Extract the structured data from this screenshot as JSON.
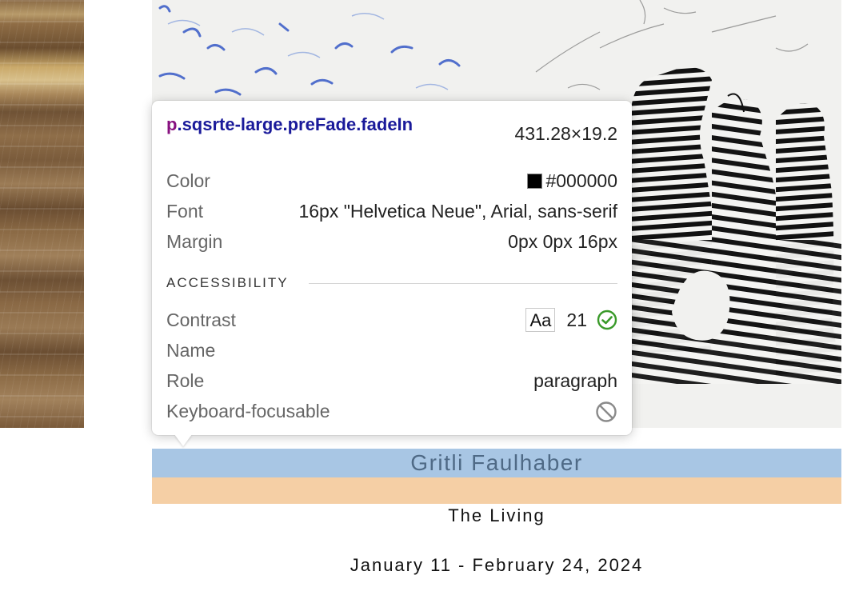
{
  "tooltip": {
    "selector_tag": "p",
    "selector_classes": ".sqsrte-large.preFade.fadeIn",
    "dimensions": "431.28×19.2",
    "color_label": "Color",
    "color_value": "#000000",
    "font_label": "Font",
    "font_value": "16px \"Helvetica Neue\", Arial, sans-serif",
    "margin_label": "Margin",
    "margin_value": "0px 0px 16px",
    "accessibility_heading": "ACCESSIBILITY",
    "contrast_label": "Contrast",
    "contrast_sample": "Aa",
    "contrast_value": "21",
    "contrast_icon": "check-circle-icon",
    "name_label": "Name",
    "role_label": "Role",
    "role_value": "paragraph",
    "keyboard_label": "Keyboard-focusable",
    "keyboard_icon": "not-allowed-icon"
  },
  "page": {
    "artist_name": "Gritli Faulhaber",
    "exhibit_title": "The Living",
    "exhibit_dates": "January 11 - February 24, 2024"
  },
  "colors": {
    "content_highlight": "#a8c6e4",
    "margin_highlight": "#f5cfa5",
    "selector_class": "#1a1a9a",
    "selector_tag": "#881280",
    "check_green": "#3a9a2a"
  }
}
